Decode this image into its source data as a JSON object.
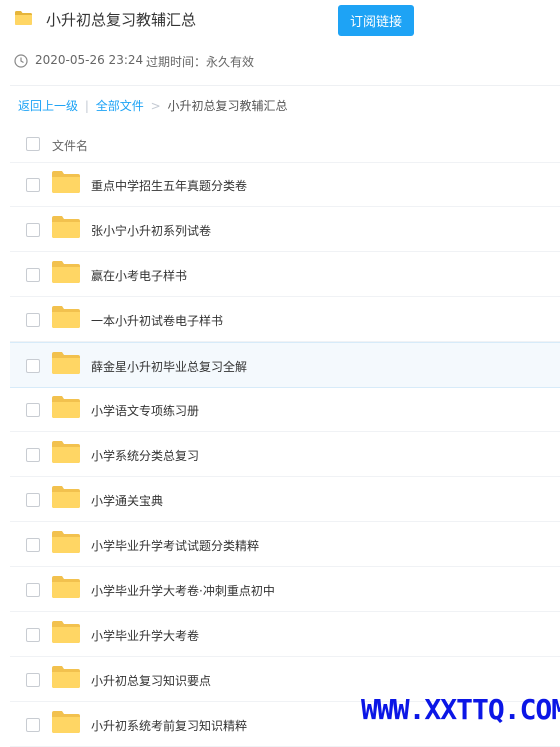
{
  "header": {
    "title": "小升初总复习教辅汇总",
    "subscribe_label": "订阅链接"
  },
  "meta": {
    "date": "2020-05-26 23:24",
    "expire": "过期时间：永久有效"
  },
  "breadcrumb": {
    "back": "返回上一级",
    "sep": "|",
    "all_files": "全部文件",
    "arrow": ">",
    "current": "小升初总复习教辅汇总"
  },
  "list": {
    "column_header": "文件名",
    "items": [
      {
        "label": "重点中学招生五年真题分类卷"
      },
      {
        "label": "张小宁小升初系列试卷"
      },
      {
        "label": "赢在小考电子样书"
      },
      {
        "label": "一本小升初试卷电子样书"
      },
      {
        "label": "薛金星小升初毕业总复习全解"
      },
      {
        "label": "小学语文专项练习册"
      },
      {
        "label": "小学系统分类总复习"
      },
      {
        "label": "小学通关宝典"
      },
      {
        "label": "小学毕业升学考试试题分类精粹"
      },
      {
        "label": "小学毕业升学大考卷·冲刺重点初中"
      },
      {
        "label": "小学毕业升学大考卷"
      },
      {
        "label": "小升初总复习知识要点"
      },
      {
        "label": "小升初系统考前复习知识精粹"
      }
    ]
  },
  "watermark": "WWW.XXTTQ.COM",
  "colors": {
    "accent": "#1ea3f5",
    "folder": "#ffd664",
    "watermark": "#0b16e6"
  }
}
